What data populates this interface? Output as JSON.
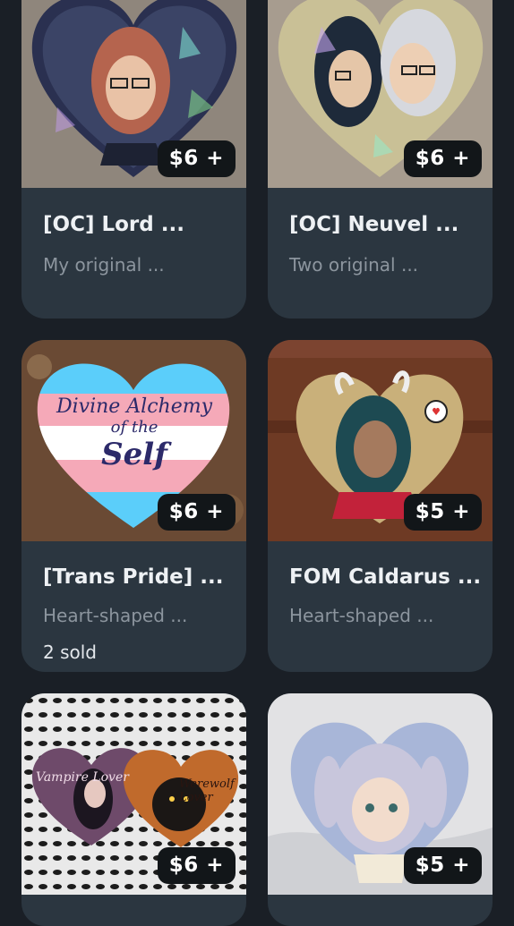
{
  "products": [
    {
      "title": "[OC] Lord ...",
      "description": "My original ...",
      "price": "$6 +",
      "image_icon": "heart-pin-image"
    },
    {
      "title": "[OC] Neuvel ...",
      "description": "Two original ...",
      "price": "$6 +",
      "image_icon": "heart-pin-image"
    },
    {
      "title": "[Trans Pride] ...",
      "description": "Heart-shaped ...",
      "price": "$6 +",
      "sold": "2 sold",
      "image_icon": "heart-pin-image",
      "pin_text": {
        "line1": "Divine Alchemy",
        "line2": "of the",
        "line3": "Self"
      }
    },
    {
      "title": "FOM Caldarus ...",
      "description": "Heart-shaped ...",
      "price": "$5 +",
      "image_icon": "heart-pin-image"
    },
    {
      "title": "",
      "description": "",
      "price": "$6 +",
      "image_icon": "heart-pin-image",
      "pin_text": {
        "left": "Vampire Lover",
        "right": "Werewolf Lover"
      }
    },
    {
      "title": "",
      "description": "",
      "price": "$5 +",
      "image_icon": "heart-pin-image"
    }
  ],
  "colors": {
    "background": "#1a1f26",
    "card": "#2b3640",
    "price_badge": "#121619",
    "title": "#eef1f4",
    "description": "#8c959e"
  }
}
